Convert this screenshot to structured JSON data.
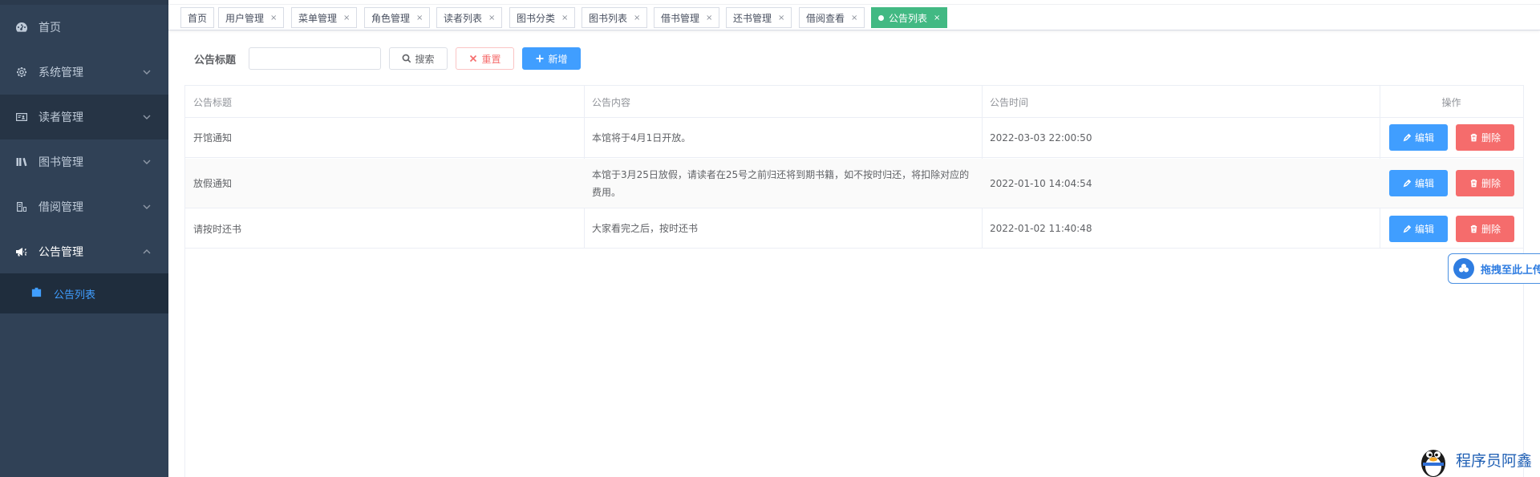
{
  "sidebar": {
    "items": [
      {
        "label": "首页",
        "icon": "dashboard-icon"
      },
      {
        "label": "系统管理",
        "icon": "gear-icon"
      },
      {
        "label": "读者管理",
        "icon": "id-card-icon"
      },
      {
        "label": "图书管理",
        "icon": "books-icon"
      },
      {
        "label": "借阅管理",
        "icon": "borrow-icon"
      },
      {
        "label": "公告管理",
        "icon": "megaphone-icon"
      }
    ],
    "submenu": {
      "label": "公告列表",
      "icon": "notice-icon"
    }
  },
  "tabs": [
    {
      "label": "首页"
    },
    {
      "label": "用户管理"
    },
    {
      "label": "菜单管理"
    },
    {
      "label": "角色管理"
    },
    {
      "label": "读者列表"
    },
    {
      "label": "图书分类"
    },
    {
      "label": "图书列表"
    },
    {
      "label": "借书管理"
    },
    {
      "label": "还书管理"
    },
    {
      "label": "借阅查看"
    },
    {
      "label": "公告列表"
    }
  ],
  "tab_close": "×",
  "search": {
    "label": "公告标题",
    "value": "",
    "placeholder": "",
    "search_label": "搜索",
    "reset_label": "重置",
    "add_label": "新增"
  },
  "table": {
    "headers": [
      "公告标题",
      "公告内容",
      "公告时间",
      "操作"
    ],
    "rows": [
      {
        "title": "开馆通知",
        "content": "本馆将于4月1日开放。",
        "time": "2022-03-03 22:00:50"
      },
      {
        "title": "放假通知",
        "content": "本馆于3月25日放假，请读者在25号之前归还将到期书籍，如不按时归还，将扣除对应的费用。",
        "time": "2022-01-10 14:04:54"
      },
      {
        "title": "请按时还书",
        "content": "大家看完之后，按时还书",
        "time": "2022-01-02 11:40:48"
      }
    ],
    "edit_label": "编辑",
    "delete_label": "删除"
  },
  "upload_widget": {
    "label": "拖拽至此上传"
  },
  "watermark": {
    "text": "程序员阿鑫"
  },
  "colors": {
    "sidebar_bg": "#304156",
    "accent": "#409eff",
    "active_tab": "#42b983",
    "danger": "#f56c6c"
  }
}
